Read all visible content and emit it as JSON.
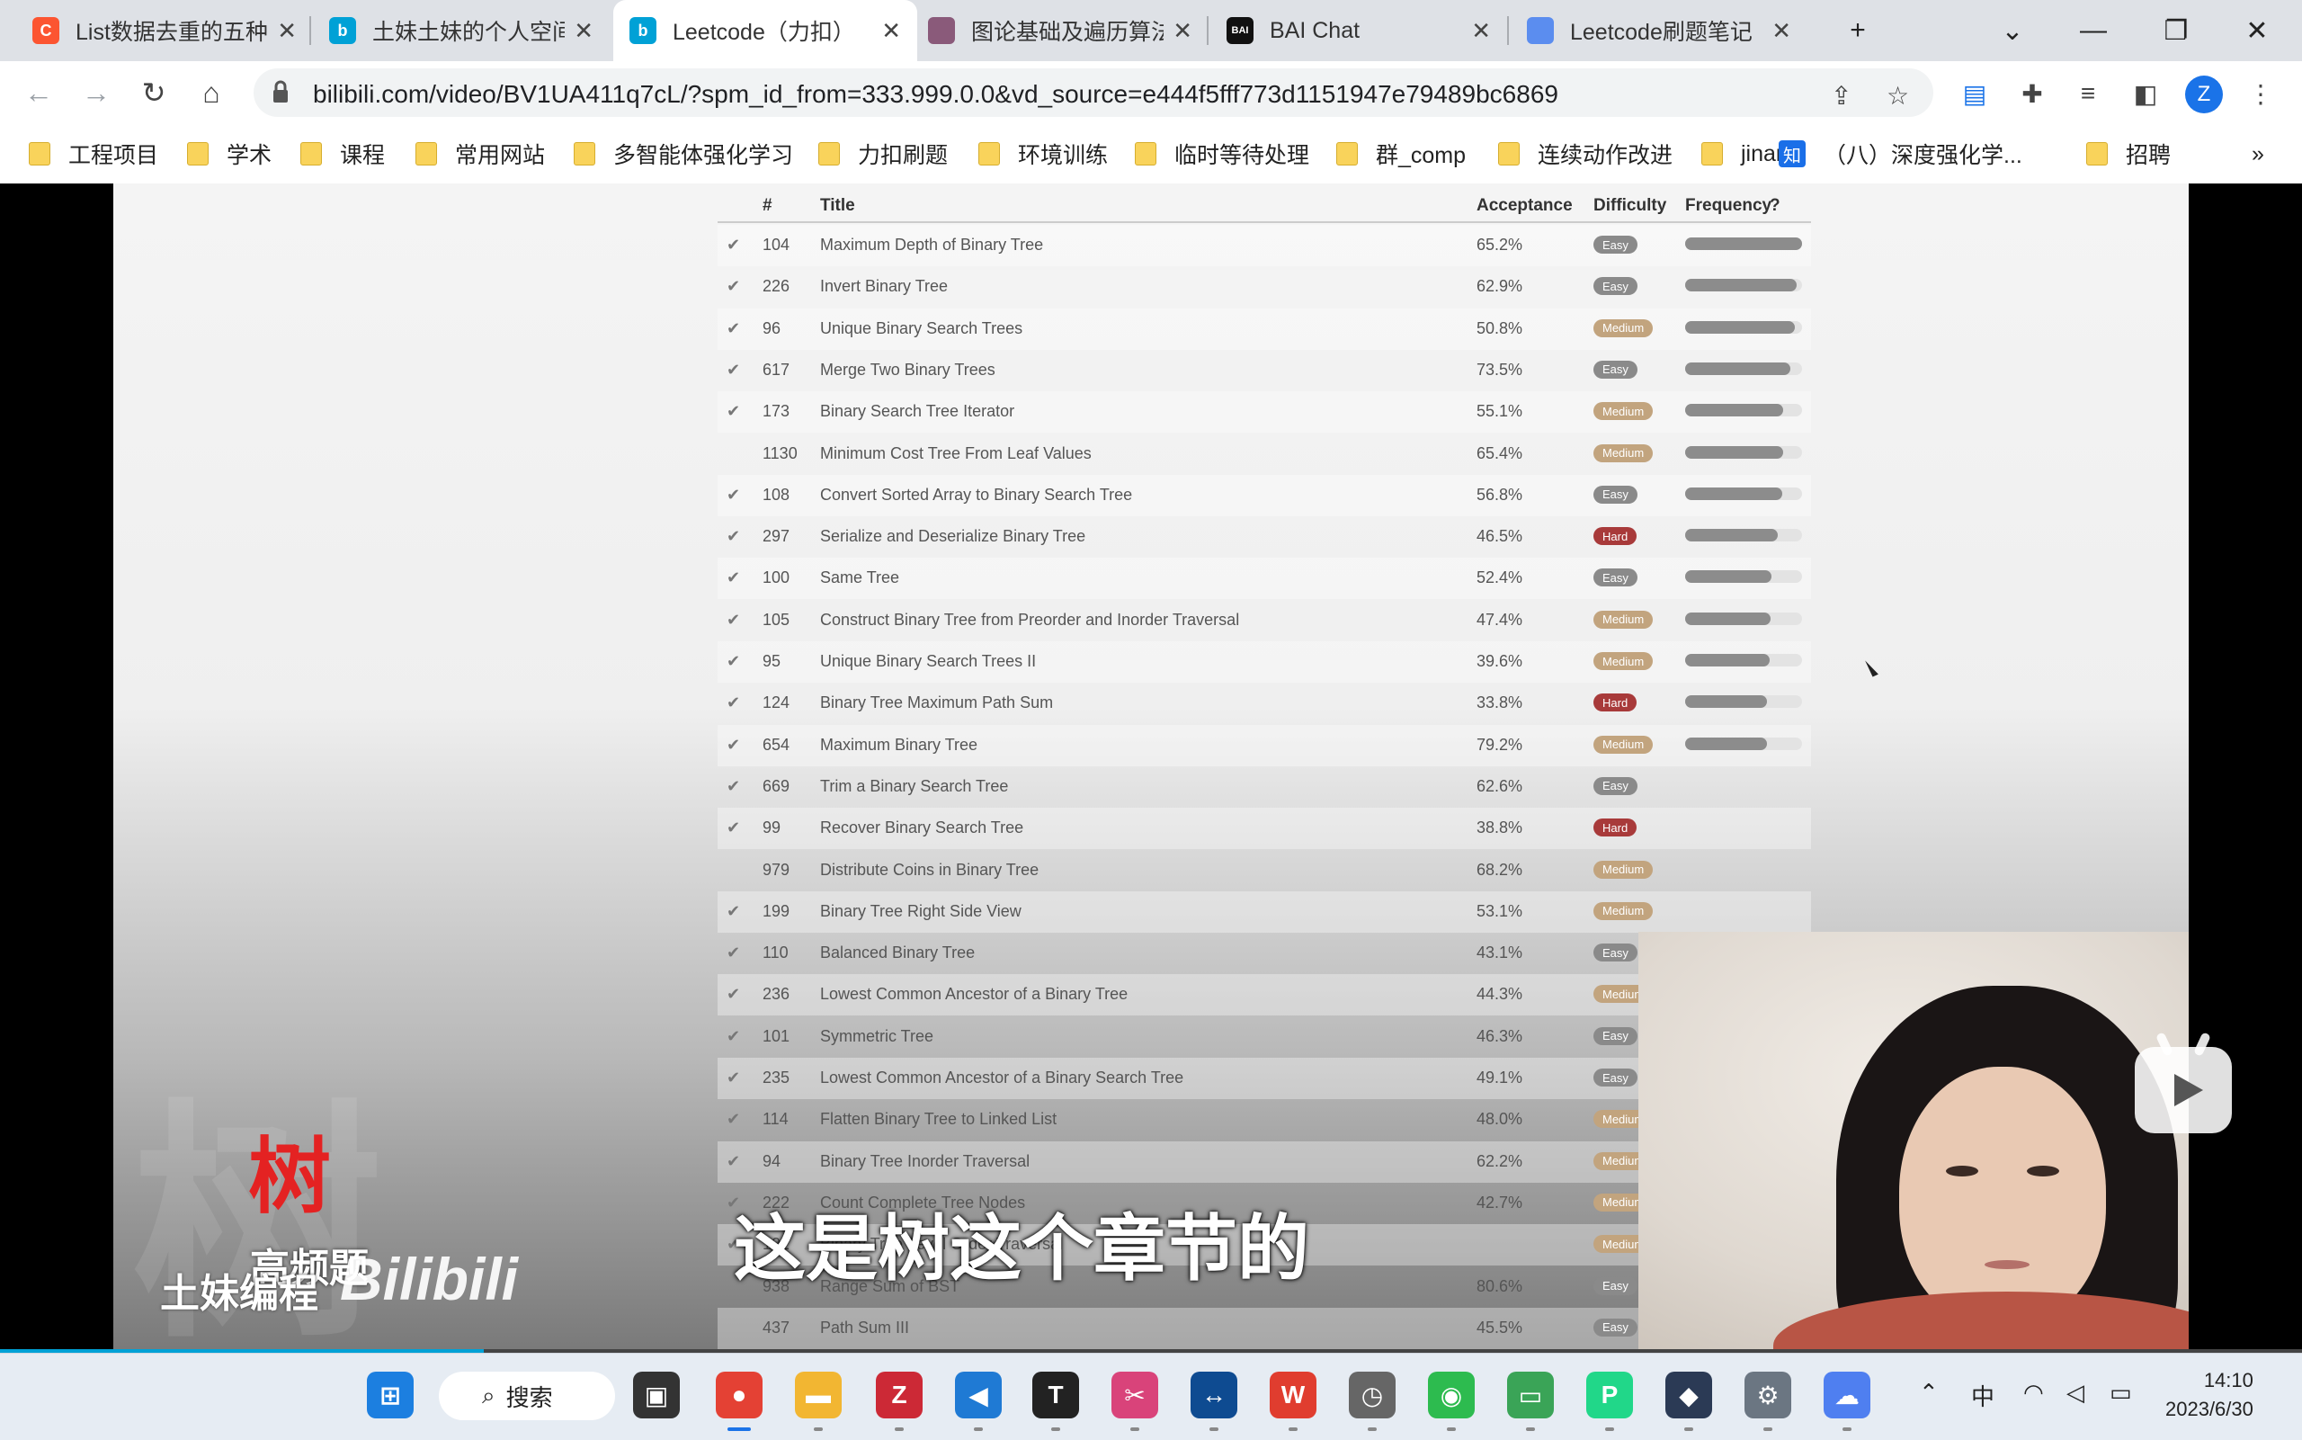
{
  "browser": {
    "tabs": [
      {
        "title": "List数据去重的五种",
        "icon": "csdn-icon",
        "color": "#fc5531",
        "glyph": "C",
        "active": false
      },
      {
        "title": "土妹土妹的个人空间",
        "icon": "bilibili-icon",
        "color": "#00a1d6",
        "glyph": "b",
        "active": false
      },
      {
        "title": "Leetcode（力扣）",
        "icon": "bilibili-icon",
        "color": "#00a1d6",
        "glyph": "b",
        "active": true
      },
      {
        "title": "图论基础及遍历算法",
        "icon": "avatar-icon",
        "color": "#8a5a7a",
        "glyph": "",
        "active": false
      },
      {
        "title": "BAI Chat",
        "icon": "bai-icon",
        "color": "#111111",
        "glyph": "BAI",
        "active": false
      },
      {
        "title": "Leetcode刷题笔记",
        "icon": "cloud-icon",
        "color": "#5b8def",
        "glyph": "",
        "active": false
      }
    ],
    "new_tab": "+",
    "url": "bilibili.com/video/BV1UA411q7cL/?spm_id_from=333.999.0.0&vd_source=e444f5fff773d1151947e79489bc6869",
    "profile_initial": "Z",
    "bookmarks": [
      {
        "label": "工程项目",
        "type": "folder"
      },
      {
        "label": "学术",
        "type": "folder"
      },
      {
        "label": "课程",
        "type": "folder"
      },
      {
        "label": "常用网站",
        "type": "folder"
      },
      {
        "label": "多智能体强化学习",
        "type": "folder"
      },
      {
        "label": "力扣刷题",
        "type": "folder"
      },
      {
        "label": "环境训练",
        "type": "folder"
      },
      {
        "label": "临时等待处理",
        "type": "folder"
      },
      {
        "label": "群_comp",
        "type": "folder"
      },
      {
        "label": "连续动作改进",
        "type": "folder"
      },
      {
        "label": "jinan",
        "type": "folder"
      },
      {
        "label": "（八）深度强化学...",
        "type": "zhihu"
      },
      {
        "label": "招聘",
        "type": "folder"
      }
    ],
    "bookmark_zhihu_glyph": "知",
    "more_bookmarks": "»"
  },
  "video": {
    "table_headers": {
      "num": "#",
      "title": "Title",
      "acceptance": "Acceptance",
      "difficulty": "Difficulty",
      "frequency": "Frequency"
    },
    "problems": [
      {
        "solved": true,
        "num": "104",
        "title": "Maximum Depth of Binary Tree",
        "acceptance": "65.2%",
        "difficulty": "Easy",
        "frequency": 1.0
      },
      {
        "solved": true,
        "num": "226",
        "title": "Invert Binary Tree",
        "acceptance": "62.9%",
        "difficulty": "Easy",
        "frequency": 0.95
      },
      {
        "solved": true,
        "num": "96",
        "title": "Unique Binary Search Trees",
        "acceptance": "50.8%",
        "difficulty": "Medium",
        "frequency": 0.94
      },
      {
        "solved": true,
        "num": "617",
        "title": "Merge Two Binary Trees",
        "acceptance": "73.5%",
        "difficulty": "Easy",
        "frequency": 0.9
      },
      {
        "solved": true,
        "num": "173",
        "title": "Binary Search Tree Iterator",
        "acceptance": "55.1%",
        "difficulty": "Medium",
        "frequency": 0.84
      },
      {
        "solved": false,
        "num": "1130",
        "title": "Minimum Cost Tree From Leaf Values",
        "acceptance": "65.4%",
        "difficulty": "Medium",
        "frequency": 0.84
      },
      {
        "solved": true,
        "num": "108",
        "title": "Convert Sorted Array to Binary Search Tree",
        "acceptance": "56.8%",
        "difficulty": "Easy",
        "frequency": 0.83
      },
      {
        "solved": true,
        "num": "297",
        "title": "Serialize and Deserialize Binary Tree",
        "acceptance": "46.5%",
        "difficulty": "Hard",
        "frequency": 0.79
      },
      {
        "solved": true,
        "num": "100",
        "title": "Same Tree",
        "acceptance": "52.4%",
        "difficulty": "Easy",
        "frequency": 0.74
      },
      {
        "solved": true,
        "num": "105",
        "title": "Construct Binary Tree from Preorder and Inorder Traversal",
        "acceptance": "47.4%",
        "difficulty": "Medium",
        "frequency": 0.73
      },
      {
        "solved": true,
        "num": "95",
        "title": "Unique Binary Search Trees II",
        "acceptance": "39.6%",
        "difficulty": "Medium",
        "frequency": 0.72
      },
      {
        "solved": true,
        "num": "124",
        "title": "Binary Tree Maximum Path Sum",
        "acceptance": "33.8%",
        "difficulty": "Hard",
        "frequency": 0.7
      },
      {
        "solved": true,
        "num": "654",
        "title": "Maximum Binary Tree",
        "acceptance": "79.2%",
        "difficulty": "Medium",
        "frequency": 0.7
      },
      {
        "solved": true,
        "num": "669",
        "title": "Trim a Binary Search Tree",
        "acceptance": "62.6%",
        "difficulty": "Easy",
        "frequency": 0.0
      },
      {
        "solved": true,
        "num": "99",
        "title": "Recover Binary Search Tree",
        "acceptance": "38.8%",
        "difficulty": "Hard",
        "frequency": 0.0
      },
      {
        "solved": false,
        "num": "979",
        "title": "Distribute Coins in Binary Tree",
        "acceptance": "68.2%",
        "difficulty": "Medium",
        "frequency": 0.0
      },
      {
        "solved": true,
        "num": "199",
        "title": "Binary Tree Right Side View",
        "acceptance": "53.1%",
        "difficulty": "Medium",
        "frequency": 0.0
      },
      {
        "solved": true,
        "num": "110",
        "title": "Balanced Binary Tree",
        "acceptance": "43.1%",
        "difficulty": "Easy",
        "frequency": 0.0
      },
      {
        "solved": true,
        "num": "236",
        "title": "Lowest Common Ancestor of a Binary Tree",
        "acceptance": "44.3%",
        "difficulty": "Medium",
        "frequency": 0.0
      },
      {
        "solved": true,
        "num": "101",
        "title": "Symmetric Tree",
        "acceptance": "46.3%",
        "difficulty": "Easy",
        "frequency": 0.0
      },
      {
        "solved": true,
        "num": "235",
        "title": "Lowest Common Ancestor of a Binary Search Tree",
        "acceptance": "49.1%",
        "difficulty": "Easy",
        "frequency": 0.0
      },
      {
        "solved": true,
        "num": "114",
        "title": "Flatten Binary Tree to Linked List",
        "acceptance": "48.0%",
        "difficulty": "Medium",
        "frequency": 0.0
      },
      {
        "solved": true,
        "num": "94",
        "title": "Binary Tree Inorder Traversal",
        "acceptance": "62.2%",
        "difficulty": "Medium",
        "frequency": 0.0
      },
      {
        "solved": true,
        "num": "222",
        "title": "Count Complete Tree Nodes",
        "acceptance": "42.7%",
        "difficulty": "Medium",
        "frequency": 0.0
      },
      {
        "solved": true,
        "num": "102",
        "title": "Binary Tree Level Order Traversal",
        "acceptance": "",
        "difficulty": "Medium",
        "frequency": 0.0
      },
      {
        "solved": false,
        "num": "938",
        "title": "Range Sum of BST",
        "acceptance": "80.6%",
        "difficulty": "Easy",
        "frequency": 0.0
      },
      {
        "solved": false,
        "num": "437",
        "title": "Path Sum III",
        "acceptance": "45.5%",
        "difficulty": "Easy",
        "frequency": 0.0
      }
    ],
    "difficulty_colors": {
      "Easy": "#8a8a8a",
      "Medium": "#c2a47e",
      "Hard": "#a83a3a"
    },
    "overlay_title": "树",
    "overlay_subtitle": "高频题",
    "author": "土妹编程",
    "logo": "Bilibili",
    "caption": "这是树这个章节的",
    "progress": 0.21
  },
  "taskbar": {
    "search_label": "搜索",
    "apps": [
      {
        "name": "start-button",
        "glyph": "⊞",
        "color": "#1c7fe0"
      },
      {
        "name": "taskview-button",
        "glyph": "▣",
        "color": "#333333"
      },
      {
        "name": "chrome-app",
        "glyph": "●",
        "color": "#e44134"
      },
      {
        "name": "explorer-app",
        "glyph": "▬",
        "color": "#f2b632"
      },
      {
        "name": "zotero-app",
        "glyph": "Z",
        "color": "#cc2936"
      },
      {
        "name": "vscode-app",
        "glyph": "◀",
        "color": "#1f7ad4"
      },
      {
        "name": "typora-app",
        "glyph": "T",
        "color": "#222222"
      },
      {
        "name": "snip-app",
        "glyph": "✂",
        "color": "#d9437a"
      },
      {
        "name": "teamviewer-app",
        "glyph": "↔",
        "color": "#0e4b91"
      },
      {
        "name": "wps-app",
        "glyph": "W",
        "color": "#e03d2f"
      },
      {
        "name": "clock-app",
        "glyph": "◷",
        "color": "#666666"
      },
      {
        "name": "wechat-app",
        "glyph": "◉",
        "color": "#2dbb4f"
      },
      {
        "name": "remote-app",
        "glyph": "▭",
        "color": "#3aa457"
      },
      {
        "name": "pycharm-app",
        "glyph": "P",
        "color": "#21d789"
      },
      {
        "name": "cat-app",
        "glyph": "◆",
        "color": "#2b3a55"
      },
      {
        "name": "settings-app",
        "glyph": "⚙",
        "color": "#6b7682"
      },
      {
        "name": "cloud-app",
        "glyph": "☁",
        "color": "#4f7ff0"
      }
    ],
    "tray_ime": "中",
    "time": "14:10",
    "date": "2023/6/30"
  }
}
